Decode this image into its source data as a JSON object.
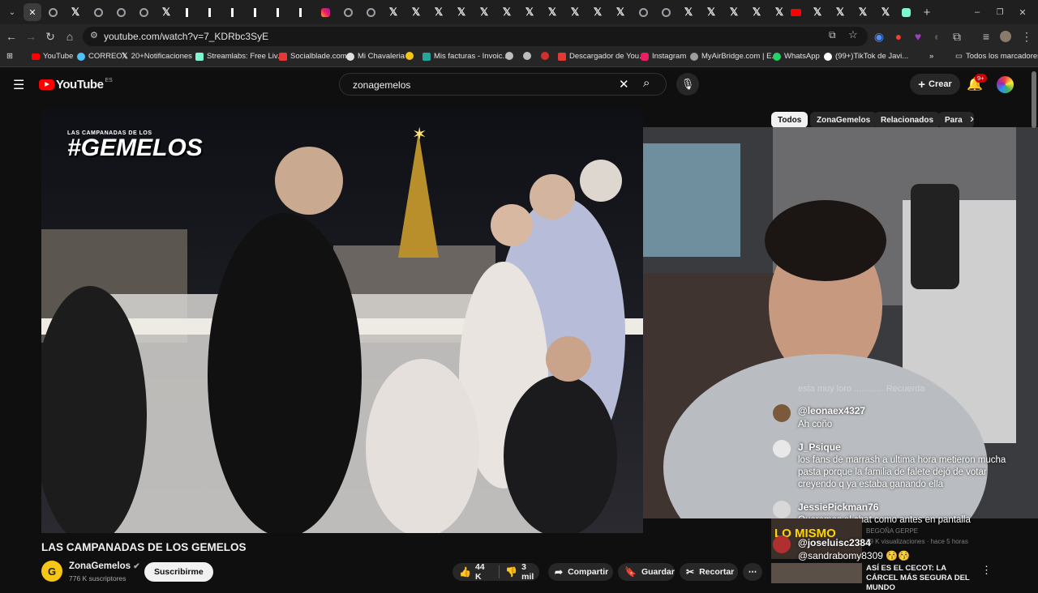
{
  "browser": {
    "url": "youtube.com/watch?v=7_KDRbc3SyE",
    "bookmarks": [
      "YouTube",
      "CORREO",
      "20+Notificaciones",
      "Streamlabs: Free Liv...",
      "Socialblade.com",
      "Mi Chavaleria",
      "",
      "Mis facturas - Invoic...",
      "",
      "",
      "",
      "Descargador de You...",
      "Instagram",
      "MyAirBridge.com | E...",
      "WhatsApp",
      "(99+)TikTok de Javi..."
    ],
    "all_bookmarks": "Todos los marcadores"
  },
  "youtube": {
    "logo": "YouTube",
    "region": "ES",
    "search_query": "zonagemelos",
    "create_label": "Crear",
    "notif_count": "9+"
  },
  "chips": [
    "Todos",
    "ZonaGemelos",
    "Relacionados",
    "Para"
  ],
  "video": {
    "overlay_hashtag": "#GEMELOS",
    "overlay_top": "LAS CAMPANADAS DE LOS",
    "title": "LAS CAMPANADAS DE LOS GEMELOS"
  },
  "channel": {
    "name": "ZonaGemelos",
    "subs": "776 K suscriptores",
    "subscribe": "Suscribirme"
  },
  "actions": {
    "likes": "44 K",
    "dislikes": "3 mil",
    "share": "Compartir",
    "save": "Guardar",
    "clip": "Recortar"
  },
  "chat": {
    "faded": "esta muy loro ............ Recuerda",
    "messages": [
      {
        "user": "@leonaex4327",
        "msg": "Ah coño"
      },
      {
        "user": "J_Psique",
        "msg": "los fans de marrash a ultima hora metieron mucha pasta porque la familia de falete dejó de votar creyendo q ya estaba ganando ella"
      },
      {
        "user": "JessiePickman76",
        "msg": "Queremos el chat como antes en pantalla"
      },
      {
        "user": "@joseluisc2384",
        "msg": ""
      },
      {
        "user": "@sandrabomy8309",
        "msg": "😚😚"
      }
    ]
  },
  "sidebar_under": {
    "channel": "BEGOÑA GERPE",
    "meta": "99 K visualizaciones · hace 5 horas",
    "next_title": "ASÍ ES EL CECOT: LA CÁRCEL MÁS SEGURA DEL MUNDO",
    "thumb_text": "LO MISMO"
  },
  "colors": {
    "yt_red": "#ff0000",
    "bg": "#0f0f0f",
    "accent": "#3ea6ff"
  }
}
